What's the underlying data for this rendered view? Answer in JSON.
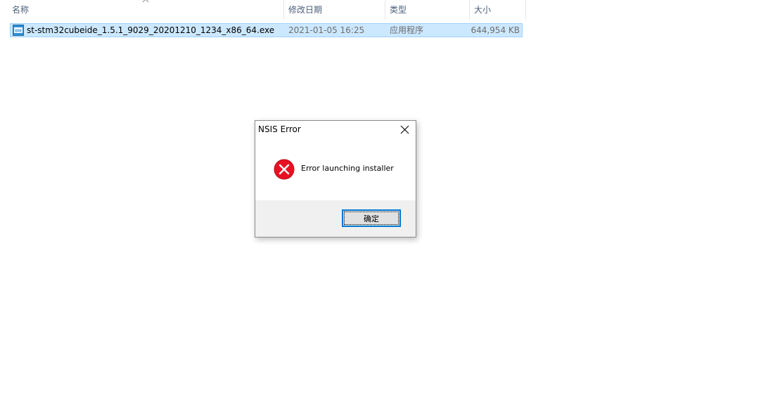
{
  "explorer": {
    "columns": {
      "name": "名称",
      "modified": "修改日期",
      "type": "类型",
      "size": "大小"
    },
    "files": [
      {
        "name": "st-stm32cubeide_1.5.1_9029_20201210_1234_x86_64.exe",
        "modified": "2021-01-05 16:25",
        "type": "应用程序",
        "size": "644,954 KB",
        "icon": "ide-installer-icon",
        "selected": true
      }
    ]
  },
  "dialog": {
    "title": "NSIS Error",
    "message": "Error launching installer",
    "ok_label": "确定",
    "icon": "error-icon"
  },
  "colors": {
    "selection_bg": "#cce8ff",
    "selection_border": "#99d1ff",
    "header_text": "#4c607a",
    "error_red": "#e81123",
    "button_focus": "#0078d7"
  }
}
